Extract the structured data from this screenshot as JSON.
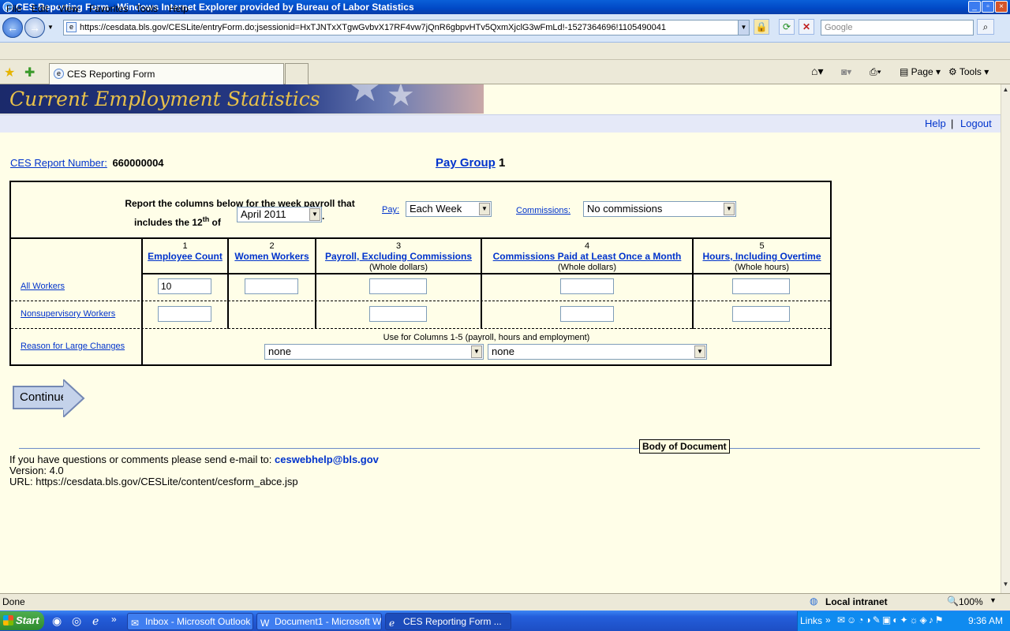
{
  "window": {
    "title": "CES Reporting Form - Windows Internet Explorer provided by Bureau of Labor Statistics",
    "min": "_",
    "max": "▫",
    "close": "×"
  },
  "address": {
    "url": "https://cesdata.bls.gov/CESLite/entryForm.do;jsessionid=HxTJNTxXTgwGvbvX17RF4vw7jQnR6gbpvHTv5QxmXjclG3wFmLd!-1527364696!1105490041",
    "search_placeholder": "Google"
  },
  "menubar": [
    "File",
    "Edit",
    "View",
    "Favorites",
    "Tools",
    "Help"
  ],
  "tab": {
    "label": "CES Reporting Form"
  },
  "commandbar": {
    "page": "Page",
    "tools": "Tools"
  },
  "banner": {
    "title": "Current Employment Statistics"
  },
  "toplinks": {
    "help": "Help",
    "sep": "|",
    "logout": "Logout"
  },
  "report": {
    "label": "CES Report Number:",
    "number": "660000004"
  },
  "paygroup": {
    "label": "Pay Group",
    "number": "1"
  },
  "form": {
    "instruction_line1": "Report the columns below for the week payroll that",
    "instruction_line2_prefix": "includes the 12",
    "instruction_sup": "th",
    "instruction_line2_suffix": " of",
    "week_value": "April 2011",
    "period_dot": ".",
    "pay_label": "Pay:",
    "pay_value": "Each Week",
    "commissions_label": "Commissions:",
    "commissions_value": "No commissions",
    "columns": [
      {
        "num": "1",
        "title": "Employee Count",
        "unit": ""
      },
      {
        "num": "2",
        "title": "Women Workers",
        "unit": ""
      },
      {
        "num": "3",
        "title": "Payroll, Excluding Commissions",
        "unit": "(Whole dollars)"
      },
      {
        "num": "4",
        "title": "Commissions Paid at Least Once a Month",
        "unit": "(Whole dollars)"
      },
      {
        "num": "5",
        "title": "Hours, Including Overtime",
        "unit": "(Whole hours)"
      }
    ],
    "rows": [
      {
        "label": "All Workers",
        "employee_count": "10"
      },
      {
        "label": "Nonsupervisory Workers"
      },
      {
        "label": "Reason for Large Changes"
      }
    ],
    "reason_note": "Use for Columns 1-5 (payroll, hours and employment)",
    "reason_select1": "none",
    "reason_select2": "none"
  },
  "continue_label": "Continue",
  "tooltip": "Body of Document",
  "footer": {
    "contact_prefix": "If you have questions or comments please send e-mail to: ",
    "email": "ceswebhelp@bls.gov",
    "version": "Version: 4.0",
    "url": "URL: https://cesdata.bls.gov/CESLite/content/cesform_abce.jsp"
  },
  "status": {
    "text": "Done",
    "zone": "Local intranet",
    "zoom": "100%"
  },
  "taskbar": {
    "start": "Start",
    "tasks": [
      "Inbox - Microsoft Outlook",
      "Document1 - Microsoft W...",
      "CES Reporting Form ..."
    ],
    "links": "Links",
    "clock": "9:36 AM"
  }
}
